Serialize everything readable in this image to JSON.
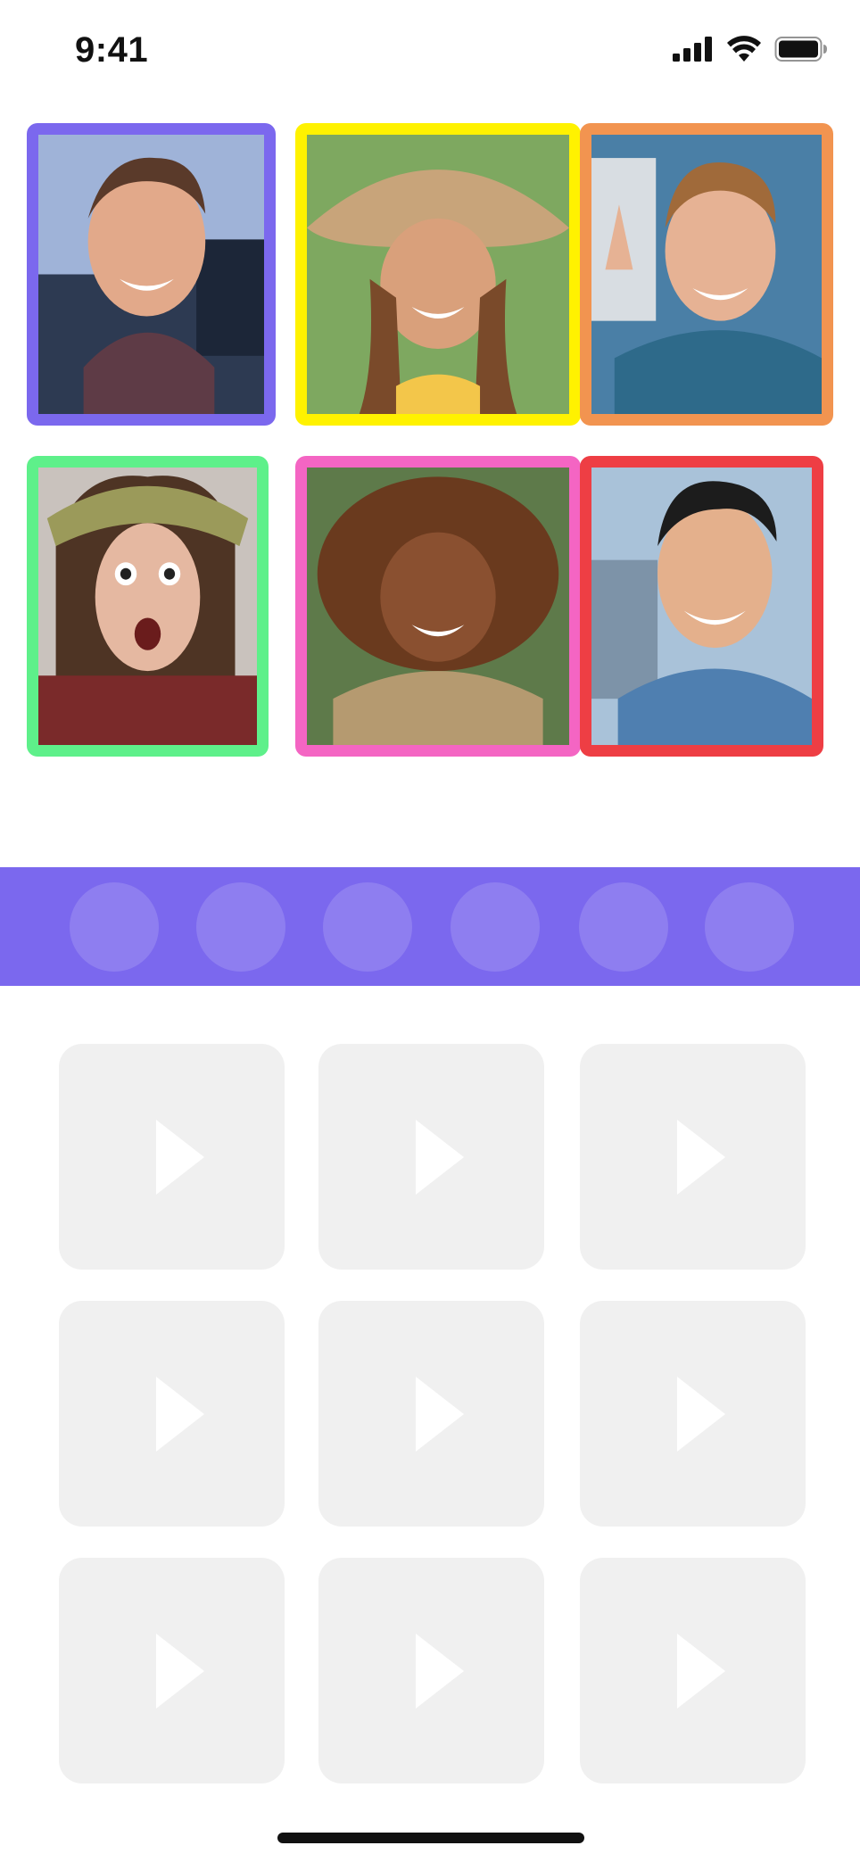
{
  "status_bar": {
    "time": "9:41",
    "icons": [
      "cellular-signal-icon",
      "wifi-icon",
      "battery-icon"
    ]
  },
  "participants": [
    {
      "name": "participant-1",
      "border_color": "#7b68ee"
    },
    {
      "name": "participant-2",
      "border_color": "#fff200"
    },
    {
      "name": "participant-3",
      "border_color": "#f29450"
    },
    {
      "name": "participant-4",
      "border_color": "#5ef08a"
    },
    {
      "name": "participant-5",
      "border_color": "#f465c3"
    },
    {
      "name": "participant-6",
      "border_color": "#ee3e44"
    }
  ],
  "reaction_band": {
    "background_color": "#7b68ee",
    "slot_count": 6
  },
  "video_grid": {
    "thumbnail_count": 9,
    "thumbnail_color": "#f0f0f0",
    "icon": "play-icon"
  }
}
